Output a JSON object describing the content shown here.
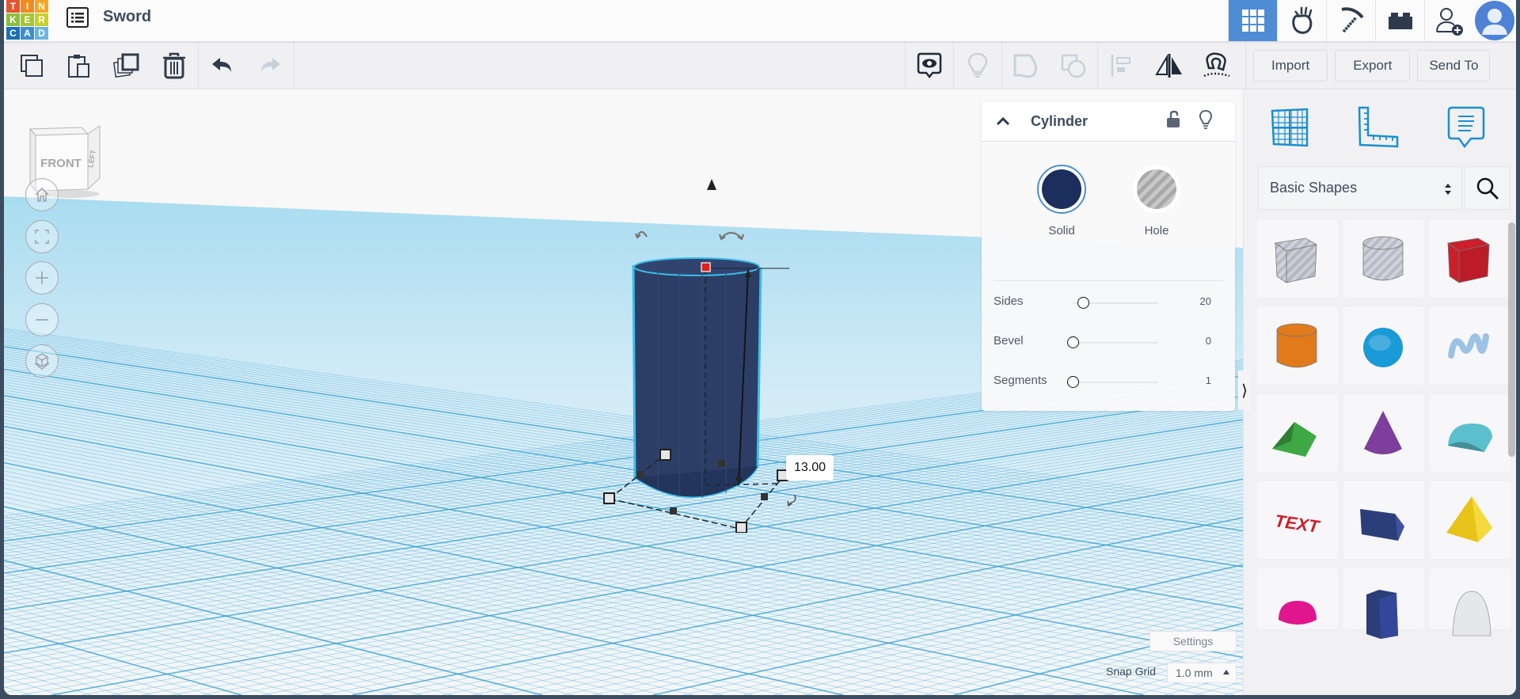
{
  "app": {
    "logo_letters": [
      "T",
      "I",
      "N",
      "K",
      "E",
      "R",
      "C",
      "A",
      "D"
    ],
    "logo_colors": [
      "#e4572e",
      "#f28b1f",
      "#f6a623",
      "#8cbd3f",
      "#a6c535",
      "#c9cf2a",
      "#1a6fb5",
      "#3b8fd0",
      "#6ab5e0"
    ],
    "design_title": "Sword"
  },
  "header": {
    "buttons": [
      {
        "name": "3d-design-view",
        "icon": "grid-icon",
        "active": true
      },
      {
        "name": "blocks-view",
        "icon": "apple-hand-icon"
      },
      {
        "name": "minecraft-view",
        "icon": "pickaxe-icon"
      },
      {
        "name": "lego-view",
        "icon": "brick-icon"
      },
      {
        "name": "invite",
        "icon": "add-user-icon"
      },
      {
        "name": "profile",
        "icon": "avatar-icon"
      }
    ],
    "accent": "#4e8dd6"
  },
  "toolbar": {
    "left": [
      {
        "name": "copy",
        "icon": "copy-icon"
      },
      {
        "name": "paste",
        "icon": "paste-icon"
      },
      {
        "name": "duplicate",
        "icon": "duplicate-icon"
      },
      {
        "name": "delete",
        "icon": "trash-icon"
      },
      {
        "name": "undo",
        "icon": "undo-icon"
      },
      {
        "name": "redo",
        "icon": "redo-icon",
        "disabled": true
      }
    ],
    "right": [
      {
        "name": "notes",
        "icon": "eye-comment-icon"
      },
      {
        "name": "show-all",
        "icon": "lightbulb-icon",
        "disabled": true
      },
      {
        "name": "group",
        "icon": "group-icon",
        "disabled": true
      },
      {
        "name": "ungroup",
        "icon": "ungroup-icon",
        "disabled": true
      },
      {
        "name": "align",
        "icon": "align-icon",
        "disabled": true
      },
      {
        "name": "mirror",
        "icon": "mirror-icon"
      },
      {
        "name": "cruise",
        "icon": "magnet-icon"
      }
    ],
    "import_label": "Import",
    "export_label": "Export",
    "send_to_label": "Send To"
  },
  "viewport": {
    "viewcube": {
      "front": "FRONT",
      "side": "LEFT"
    },
    "nav_buttons": [
      {
        "name": "home-view",
        "icon": "home-icon"
      },
      {
        "name": "fit-view",
        "icon": "fit-icon"
      },
      {
        "name": "zoom-in",
        "icon": "plus-icon"
      },
      {
        "name": "zoom-out",
        "icon": "minus-icon"
      },
      {
        "name": "perspective",
        "icon": "ortho-cube-icon"
      }
    ],
    "selected_shape": {
      "type": "Cylinder",
      "color": "#2c3e66",
      "height_dimension": "13.00"
    },
    "settings_label": "Settings",
    "snap_grid_label": "Snap Grid",
    "snap_grid_value": "1.0 mm"
  },
  "inspector": {
    "title": "Cylinder",
    "solid_label": "Solid",
    "hole_label": "Hole",
    "solid_color": "#1c2e5e",
    "selected_mode": "Solid",
    "properties": [
      {
        "label": "Sides",
        "value": "20",
        "slider_fraction": 0.12
      },
      {
        "label": "Bevel",
        "value": "0",
        "slider_fraction": 0.0
      },
      {
        "label": "Segments",
        "value": "1",
        "slider_fraction": 0.0
      }
    ]
  },
  "right_panel": {
    "tabs": [
      {
        "name": "workplane",
        "icon": "workplane-icon"
      },
      {
        "name": "ruler",
        "icon": "ruler-icon"
      },
      {
        "name": "notes",
        "icon": "note-icon"
      }
    ],
    "category": "Basic Shapes",
    "shapes": [
      {
        "name": "Box Hole",
        "color": "#c4c8d2",
        "kind": "box",
        "hole": true
      },
      {
        "name": "Cylinder Hole",
        "color": "#c4c8d2",
        "kind": "cyl",
        "hole": true
      },
      {
        "name": "Box",
        "color": "#cc1f2b",
        "kind": "box"
      },
      {
        "name": "Cylinder",
        "color": "#e07a1b",
        "kind": "cyl"
      },
      {
        "name": "Sphere",
        "color": "#1a9ad6",
        "kind": "sphere"
      },
      {
        "name": "Scribble",
        "color": "#9cc3e3",
        "kind": "scribble"
      },
      {
        "name": "Roof",
        "color": "#3ea844",
        "kind": "roof"
      },
      {
        "name": "Cone",
        "color": "#7d3f9b",
        "kind": "cone"
      },
      {
        "name": "Round Roof",
        "color": "#5bbfce",
        "kind": "roundroof"
      },
      {
        "name": "Text",
        "color": "#cc1f2b",
        "kind": "text",
        "label": "TEXT"
      },
      {
        "name": "Wedge",
        "color": "#2b3e7a",
        "kind": "wedge"
      },
      {
        "name": "Pyramid",
        "color": "#e8c31a",
        "kind": "pyramid"
      },
      {
        "name": "Half Sphere",
        "color": "#e0168f",
        "kind": "halfsphere"
      },
      {
        "name": "Polygon",
        "color": "#2b3e7a",
        "kind": "polygon"
      },
      {
        "name": "Paraboloid",
        "color": "#e6e7e9",
        "kind": "paraboloid"
      }
    ]
  }
}
